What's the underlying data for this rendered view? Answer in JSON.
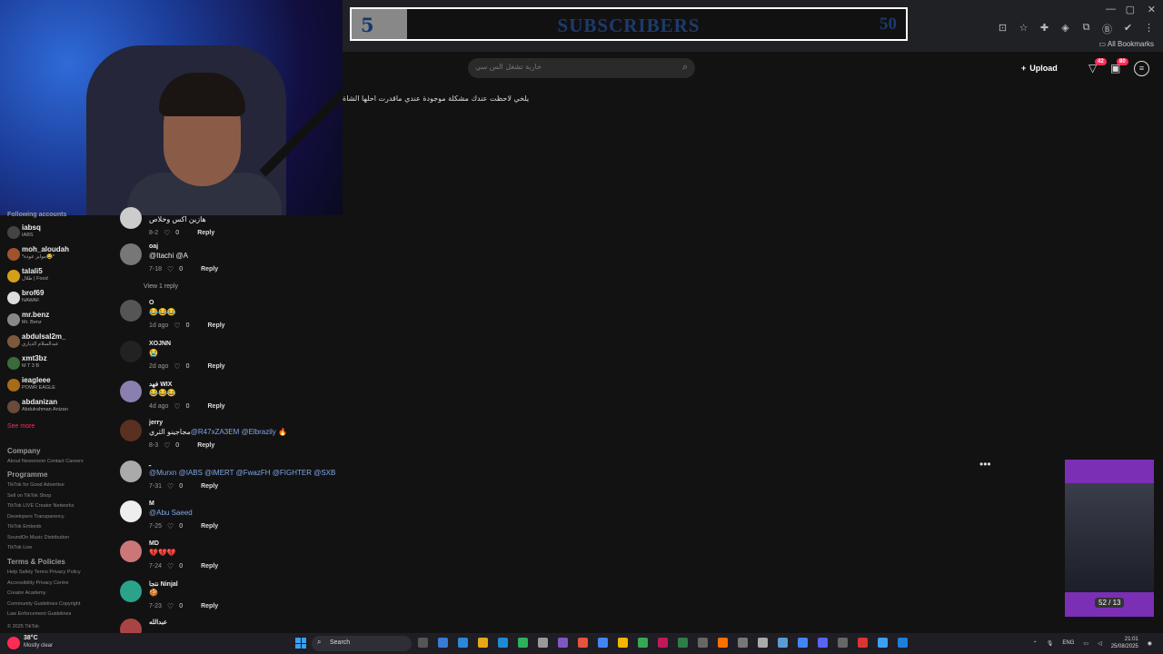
{
  "subscriber_goal": {
    "current": "5",
    "label": "SUBSCRIBERS",
    "goal": "50",
    "progress": 0.1
  },
  "browser": {
    "bookmarks_label": "All Bookmarks"
  },
  "header": {
    "search_placeholder": "خاربة تشغل الس سي",
    "upload_label": "Upload",
    "inbox_badge": "42",
    "messages_badge": "80"
  },
  "caption": "يلخي لاحظت عندك مشكلة موجودة عندي ماقدرت احلها الشاة",
  "sidebar": {
    "heading": "Following accounts",
    "accounts": [
      {
        "name": "iabsq",
        "sub": "IABS",
        "color": "#444"
      },
      {
        "name": "moh_aloudah",
        "sub": "*مواير عودة😂*",
        "color": "#a0522d"
      },
      {
        "name": "talali5",
        "sub": "طلال | Food",
        "color": "#d4a017"
      },
      {
        "name": "brof69",
        "sub": "NAWAF",
        "color": "#ddd"
      },
      {
        "name": "mr.benz",
        "sub": "Mr. Benz",
        "color": "#888"
      },
      {
        "name": "abdulsal2m_",
        "sub": "عبدالسلام الدياري",
        "color": "#7a5a3a"
      },
      {
        "name": "xmt3bz",
        "sub": "M T 3 B",
        "color": "#3a6b3a"
      },
      {
        "name": "ieagleee",
        "sub": "POWR EAGLE",
        "color": "#a86b1a"
      },
      {
        "name": "abdanizan",
        "sub": "Abdulrahman Anizan",
        "color": "#6b4a3a"
      }
    ],
    "see_more": "See more",
    "footer": {
      "company_h": "Company",
      "company_links": "About  Newsroom  Contact  Careers",
      "programme_h": "Programme",
      "programme_links": [
        "TikTok for Good  Advertise",
        "Sell on TikTok Shop",
        "TikTok LIVE Creator Networks",
        "Developers  Transparency",
        "TikTok Embeds",
        "SoundOn Music Distribution",
        "TikTok Live"
      ],
      "terms_h": "Terms & Policies",
      "terms_links": [
        "Help  Safety  Terms  Privacy Policy",
        "Accessibility  Privacy Centre",
        "Creator Academy",
        "Community Guidelines  Copyright",
        "Law Enforcement Guidelines"
      ],
      "copyright": "© 2025 TikTok"
    }
  },
  "comments": [
    {
      "user": "",
      "text": "هازين اكس وخلاص",
      "date": "8-2",
      "likes": "0",
      "reply": "Reply",
      "color": "#ccc"
    },
    {
      "user": "oaj",
      "text": "@Itachi @A",
      "date": "7-18",
      "likes": "0",
      "reply": "Reply",
      "color": "#777"
    },
    {
      "user": "O",
      "text": "😂😂😂",
      "date": "1d ago",
      "likes": "0",
      "reply": "Reply",
      "color": "#555"
    },
    {
      "user": "XOJNN",
      "text": "😭",
      "date": "2d ago",
      "likes": "0",
      "reply": "Reply",
      "color": "#222"
    },
    {
      "user": "فهد WIX",
      "text": "😂😂😂",
      "date": "4d ago",
      "likes": "0",
      "reply": "Reply",
      "color": "#8b7fb0"
    },
    {
      "user": "jerry",
      "text": "مجاجينو الثري",
      "mention": "@R47xZA3EM @Elbrazily 🔥",
      "date": "8-3",
      "likes": "0",
      "reply": "Reply",
      "color": "#5a3020"
    },
    {
      "user": "ـ",
      "text": "",
      "mention": "@Murxn @IABS @iMERT @FwazFH @FIGHTER @SXB",
      "date": "7-31",
      "likes": "0",
      "reply": "Reply",
      "color": "#aaa"
    },
    {
      "user": "M",
      "text": "",
      "mention": "@Abu Saeed",
      "date": "7-25",
      "likes": "0",
      "reply": "Reply",
      "color": "#eee"
    },
    {
      "user": "MD",
      "text": "💔💔💔",
      "date": "7-24",
      "likes": "0",
      "reply": "Reply",
      "color": "#c77"
    },
    {
      "user": "نتجا Ninjal",
      "text": "🍪",
      "date": "7-23",
      "likes": "0",
      "reply": "Reply",
      "color": "#2aa38a"
    },
    {
      "user": "عبدالله",
      "text": "",
      "date": "",
      "likes": "",
      "reply": "",
      "color": "#a44"
    }
  ],
  "view_reply": "View 1 reply",
  "mini_player": {
    "timer": "52 / 13"
  },
  "taskbar": {
    "temp": "38°C",
    "weather": "Mostly clear",
    "search": "Search",
    "lang": "ENG",
    "time": "21:01",
    "date": "25/08/2025"
  }
}
